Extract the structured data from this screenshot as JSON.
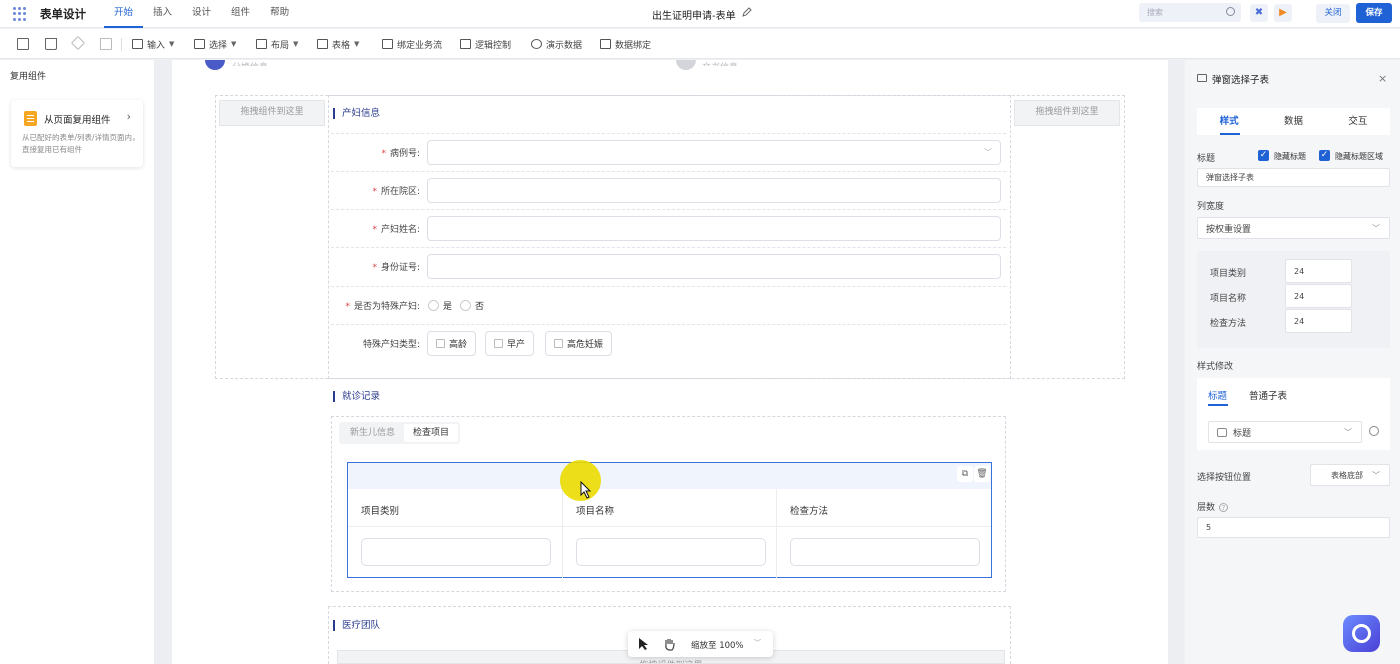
{
  "app": {
    "title": "表单设计",
    "menu": [
      "开始",
      "插入",
      "设计",
      "组件",
      "帮助"
    ],
    "doc_title": "出生证明申请-表单",
    "search_placeholder": "搜索",
    "close": "关闭",
    "save": "保存",
    "accent": "#1f62d6"
  },
  "toolbar": {
    "input": "输入",
    "select": "选择",
    "layout": "布局",
    "table": "表格",
    "bind_flow": "绑定业务流",
    "logic": "逻辑控制",
    "demo": "演示数据",
    "data_bind": "数据绑定"
  },
  "left": {
    "header": "复用组件",
    "card_title": "从页面复用组件",
    "card_desc": "从已配好的表单/列表/详情页面内，直接复用已有组件"
  },
  "canvas": {
    "step1": "分娩信息",
    "step2": "文书信息",
    "drop_hint": "拖拽组件到这里",
    "section1": "产妇信息",
    "fields": [
      {
        "label": "病例号:",
        "required": "*"
      },
      {
        "label": "所在院区:",
        "required": "*"
      },
      {
        "label": "产妇姓名:",
        "required": "*"
      },
      {
        "label": "身份证号:",
        "required": "*"
      },
      {
        "label": "是否为特殊产妇:",
        "required": "*"
      },
      {
        "label": "特殊产妇类型:",
        "required": ""
      }
    ],
    "radio_yes": "是",
    "radio_no": "否",
    "checks": [
      "高龄",
      "早产",
      "高危妊娠"
    ],
    "section2": "就诊记录",
    "tabs": [
      "新生儿信息",
      "检查项目"
    ],
    "columns": [
      "项目类别",
      "项目名称",
      "检查方法"
    ],
    "section3": "医疗团队",
    "zoom": "缩放至 100%"
  },
  "right": {
    "title": "弹窗选择子表",
    "tabs": [
      "样式",
      "数据",
      "交互"
    ],
    "title_label": "标题",
    "hide_title": "隐藏标题",
    "hide_title_area": "隐藏标题区域",
    "title_value": "弹窗选择子表",
    "col_width_label": "列宽度",
    "col_width_value": "按权重设置",
    "weights": [
      {
        "name": "项目类别",
        "value": "24"
      },
      {
        "name": "项目名称",
        "value": "24"
      },
      {
        "name": "检查方法",
        "value": "24"
      }
    ],
    "style_mod": "样式修改",
    "style_tab1": "标题",
    "style_tab2": "普通子表",
    "style_select": "标题",
    "btn_pos_label": "选择按钮位置",
    "btn_pos_value": "表格底部",
    "levels_label": "层数",
    "levels_value": "5"
  }
}
